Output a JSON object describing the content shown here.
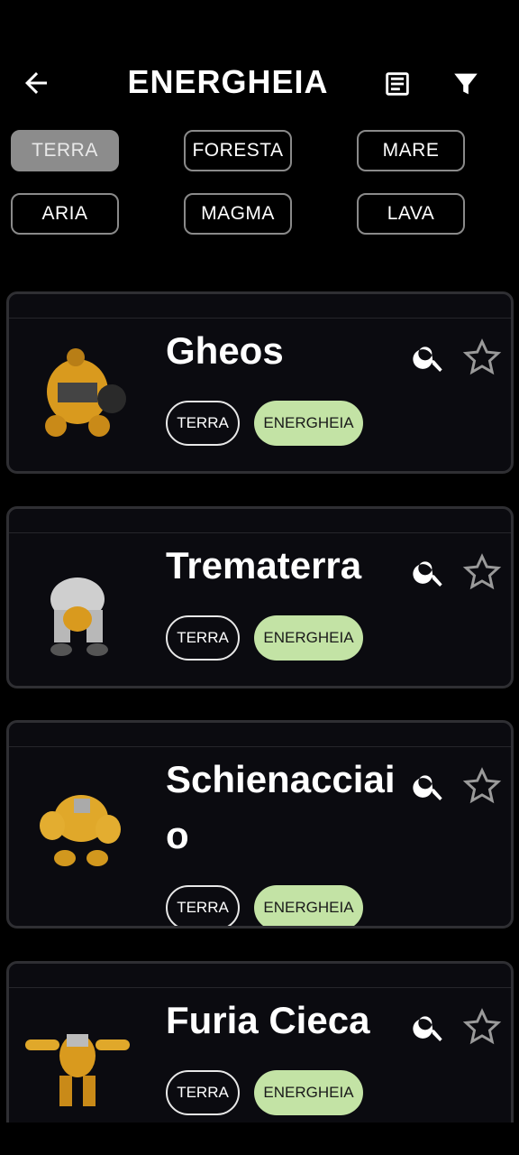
{
  "header": {
    "title": "ENERGHEIA",
    "back_icon": "arrow-left-icon",
    "list_icon": "document-icon",
    "filter_icon": "filter-icon"
  },
  "filters": [
    {
      "label": "TERRA",
      "selected": true
    },
    {
      "label": "FORESTA",
      "selected": false
    },
    {
      "label": "MARE",
      "selected": false
    },
    {
      "label": "ARIA",
      "selected": false
    },
    {
      "label": "MAGMA",
      "selected": false
    },
    {
      "label": "LAVA",
      "selected": false
    }
  ],
  "colors": {
    "background": "#000000",
    "card": "#0b0b10",
    "tag_green": "#c3e3a5",
    "selected_chip": "#8c8c8c"
  },
  "cards": [
    {
      "name": "Gheos",
      "tags": [
        "TERRA",
        "ENERGHEIA"
      ],
      "search_icon": "search-icon",
      "star_icon": "star-outline-icon"
    },
    {
      "name": "Trematerra",
      "tags": [
        "TERRA",
        "ENERGHEIA"
      ],
      "search_icon": "search-icon",
      "star_icon": "star-outline-icon"
    },
    {
      "name": "Schienacciaio",
      "tags": [
        "TERRA",
        "ENERGHEIA"
      ],
      "search_icon": "search-icon",
      "star_icon": "star-outline-icon"
    },
    {
      "name": "Furia Cieca",
      "tags": [
        "TERRA",
        "ENERGHEIA"
      ],
      "search_icon": "search-icon",
      "star_icon": "star-outline-icon"
    }
  ]
}
